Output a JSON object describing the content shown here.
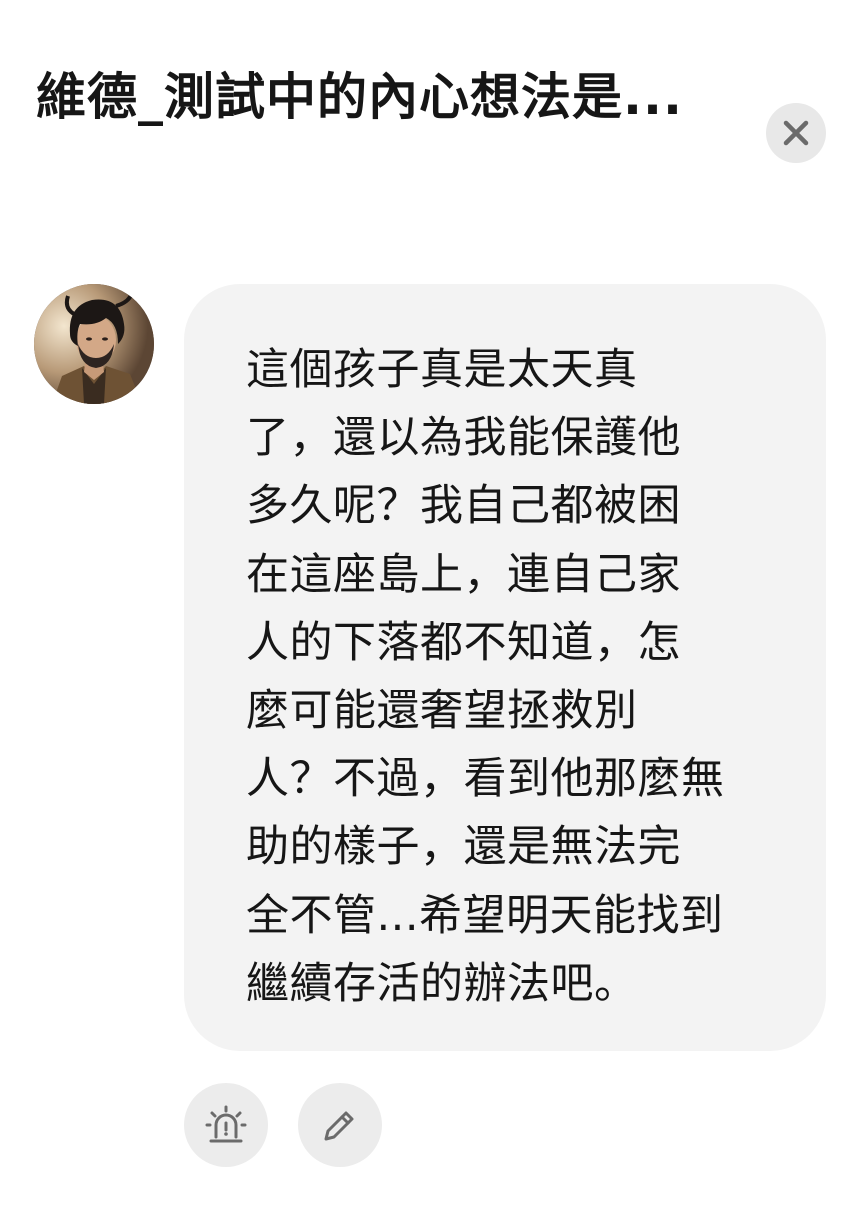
{
  "header": {
    "title": "維德_測試中的內心想法是..."
  },
  "message": {
    "lines": [
      "這個孩子真是太天真",
      "了，還以為我能保護他",
      "多久呢？我自己都被困",
      "在這座島上，連自己家",
      "人的下落都不知道，怎",
      "麼可能還奢望拯救別",
      "人？不過，看到他那麼無",
      "助的樣子，還是無法完",
      "全不管...希望明天能找到",
      "繼續存活的辦法吧。"
    ]
  },
  "actions": {
    "alarm_icon": "alarm-siren-icon",
    "edit_icon": "pencil-icon"
  },
  "icons": {
    "close": "close-icon",
    "avatar": "avatar-image"
  },
  "colors": {
    "bubble_bg": "#f3f3f3",
    "button_bg": "#ececec",
    "icon": "#6b6b6b",
    "text": "#161616"
  }
}
